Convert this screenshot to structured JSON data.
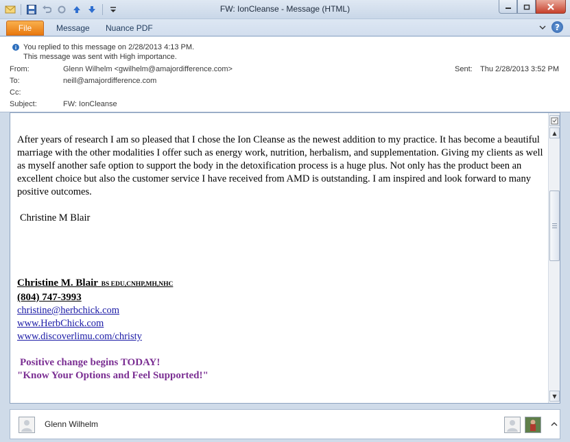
{
  "window": {
    "title": "FW: IonCleanse  -  Message (HTML)"
  },
  "qat_icons": [
    "envelope-icon",
    "save-icon",
    "undo-icon",
    "redo-icon",
    "arrow-up-icon",
    "arrow-down-icon",
    "customize-icon"
  ],
  "ribbon": {
    "tabs": [
      "File",
      "Message",
      "Nuance PDF"
    ]
  },
  "header": {
    "info_lines": [
      "You replied to this message on 2/28/2013 4:13 PM.",
      "This message was sent with High importance."
    ],
    "from_label": "From:",
    "from_value": "Glenn Wilhelm <gwilhelm@amajordifference.com>",
    "to_label": "To:",
    "to_value": "neill@amajordifference.com",
    "cc_label": "Cc:",
    "cc_value": "",
    "subject_label": "Subject:",
    "subject_value": "FW: IonCleanse",
    "sent_label": "Sent:",
    "sent_value": "Thu 2/28/2013 3:52 PM"
  },
  "body": {
    "paragraph": "After years of research I am so pleased that I chose the Ion Cleanse as the newest addition to my practice.  It has become a beautiful marriage with the other modalities I offer such as energy work, nutrition, herbalism, and supplementation.   Giving my clients as well as myself another safe option to support the body in the detoxification process is a huge plus.   Not only has the product been an excellent choice but also the customer service I have received from AMD is outstanding.  I am inspired and look forward to many positive outcomes.",
    "signoff": "Christine M Blair",
    "signature": {
      "name": "Christine M. Blair",
      "credentials": "BS EDU,CNHP,MH,NHC",
      "phone": "(804) 747-3993",
      "email": "christine@herbchick.com",
      "website1": "www.HerbChick.com",
      "website2": "www.discoverlimu.com/christy",
      "slogan1": "Positive change begins TODAY!",
      "slogan2": "\"Know Your Options and Feel Supported!\""
    }
  },
  "people_pane": {
    "name": "Glenn Wilhelm"
  },
  "colors": {
    "file_tab": "#e8780f",
    "link": "#1a1aa6",
    "slogan": "#7b2f93",
    "frame": "#cfdbe9"
  }
}
